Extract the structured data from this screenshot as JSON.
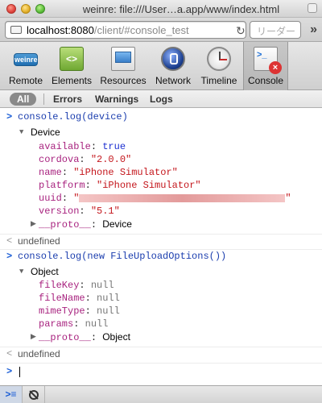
{
  "window": {
    "title": "weinre: file:///User…a.app/www/index.html"
  },
  "address": {
    "url_host": "localhost:8080",
    "url_path": "/client/#console_test",
    "reader_label": "リーダー"
  },
  "toolbar": {
    "items": [
      {
        "label": "Remote",
        "icon_text": "weinre"
      },
      {
        "label": "Elements",
        "icon_text": "<>"
      },
      {
        "label": "Resources"
      },
      {
        "label": "Network"
      },
      {
        "label": "Timeline"
      },
      {
        "label": "Console",
        "icon_text": ">_"
      }
    ],
    "active": "Console"
  },
  "filters": {
    "all": "All",
    "errors": "Errors",
    "warnings": "Warnings",
    "logs": "Logs"
  },
  "console": {
    "entries": [
      {
        "command": "console.log(device)",
        "object_name": "Device",
        "props": [
          {
            "key": "available",
            "value": "true"
          },
          {
            "key": "cordova",
            "value": "\"2.0.0\""
          },
          {
            "key": "name",
            "value": "\"iPhone Simulator\""
          },
          {
            "key": "platform",
            "value": "\"iPhone Simulator\""
          },
          {
            "key": "uuid",
            "value_open": "\"",
            "value_close": "\""
          },
          {
            "key": "version",
            "value": "\"5.1\""
          },
          {
            "key": "__proto__",
            "value": "Device"
          }
        ],
        "result": "undefined"
      },
      {
        "command": "console.log(new FileUploadOptions())",
        "object_name": "Object",
        "props": [
          {
            "key": "fileKey",
            "value": "null"
          },
          {
            "key": "fileName",
            "value": "null"
          },
          {
            "key": "mimeType",
            "value": "null"
          },
          {
            "key": "params",
            "value": "null"
          },
          {
            "key": "__proto__",
            "value": "Object"
          }
        ],
        "result": "undefined"
      }
    ],
    "prompt_glyph": ">",
    "result_glyph": "<",
    "input_value": ""
  }
}
